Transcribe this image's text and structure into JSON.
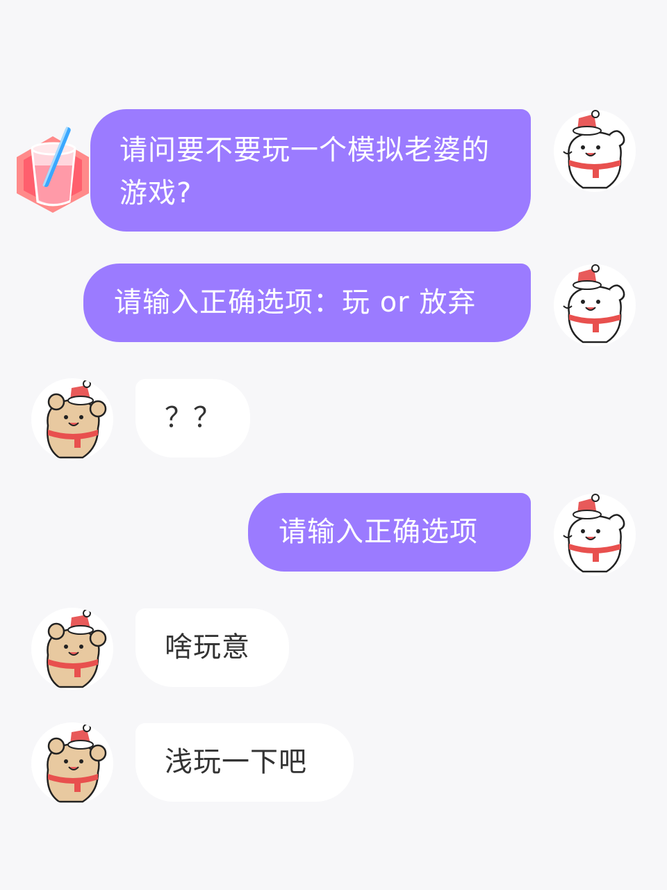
{
  "messages": [
    {
      "side": "out",
      "text": "请问要不要玩一个模拟老婆的游戏?"
    },
    {
      "side": "out",
      "text": "请输入正确选项：玩 or 放弃"
    },
    {
      "side": "in",
      "text": "？？"
    },
    {
      "side": "out",
      "text": "请输入正确选项"
    },
    {
      "side": "in",
      "text": "啥玩意"
    },
    {
      "side": "in",
      "text": "浅玩一下吧"
    }
  ],
  "colors": {
    "outgoing_bubble": "#9b7bff",
    "incoming_bubble": "#ffffff",
    "background": "#f7f7f9"
  },
  "icons": {
    "sender_avatar": "white-puppy-santa-hat-icon",
    "receiver_avatar": "tan-bear-santa-hat-icon",
    "sticker": "pink-drink-cup-icon"
  }
}
